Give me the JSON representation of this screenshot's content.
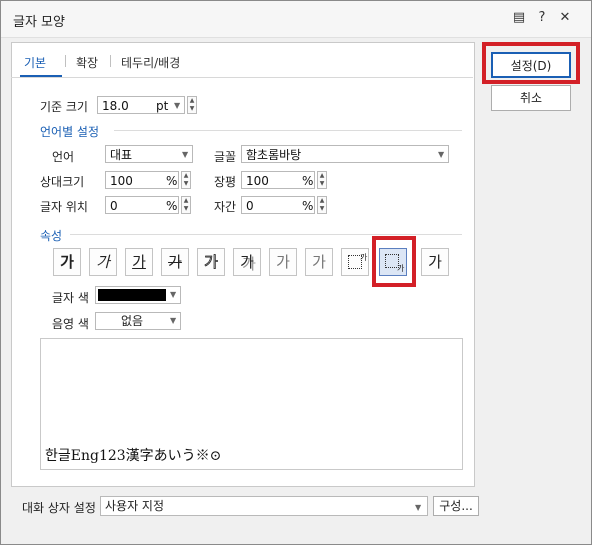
{
  "window": {
    "title": "글자 모양"
  },
  "tabs": [
    "기본",
    "확장",
    "테두리/배경"
  ],
  "base_size": {
    "label": "기준 크기",
    "value": "18.0",
    "unit": "pt"
  },
  "lang_section": {
    "title": "언어별 설정",
    "lang_label": "언어",
    "lang_value": "대표",
    "font_label": "글꼴",
    "font_value": "함초롬바탕",
    "rel_size_label": "상대크기",
    "rel_size_value": "100",
    "rel_size_unit": "%",
    "width_label": "장평",
    "width_value": "100",
    "width_unit": "%",
    "pos_label": "글자 위치",
    "pos_value": "0",
    "pos_unit": "%",
    "spacing_label": "자간",
    "spacing_value": "0",
    "spacing_unit": "%"
  },
  "attr_section": {
    "title": "속성",
    "buttons": [
      "가",
      "가",
      "가",
      "가",
      "가",
      "가",
      "가",
      "가",
      "",
      "",
      "가"
    ],
    "text_color_label": "글자 색",
    "text_color": "#000000",
    "shade_color_label": "음영 색",
    "shade_color_value": "없음"
  },
  "preview": {
    "sample": "한글Eng123漢字あいう※⊙"
  },
  "bottom": {
    "label": "대화 상자 설정",
    "value": "사용자 지정",
    "config_button": "구성..."
  },
  "actions": {
    "ok": "설정(D)",
    "cancel": "취소"
  },
  "colors": {
    "highlight": "#d32027",
    "accent": "#1a5fb4"
  }
}
